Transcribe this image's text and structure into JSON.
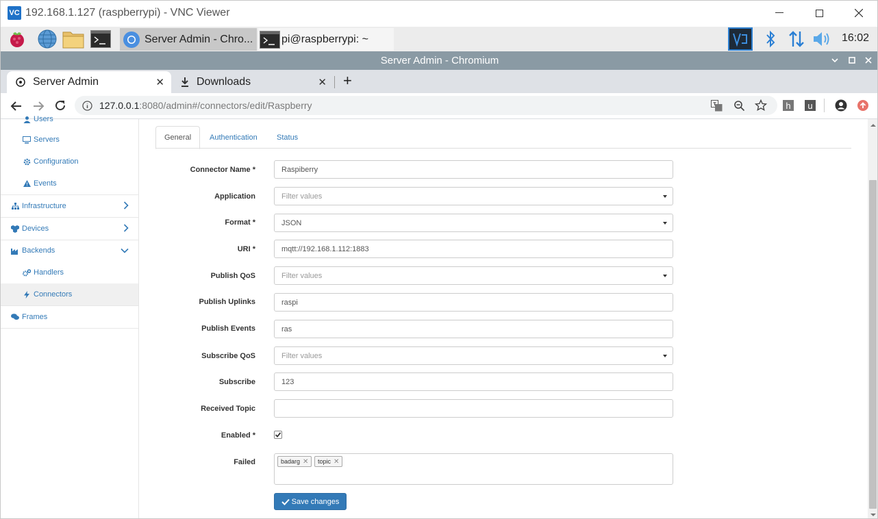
{
  "vnc": {
    "title": "192.168.1.127 (raspberrypi) - VNC Viewer",
    "logo": "VC"
  },
  "taskbar": {
    "tasks": [
      {
        "label": "Server Admin - Chro..."
      },
      {
        "label": "pi@raspberrypi: ~"
      }
    ],
    "clock": "16:02",
    "icons": [
      "raspberry-menu-icon",
      "web-browser-icon",
      "file-manager-icon",
      "terminal-icon",
      "vnc-tray-icon",
      "bluetooth-icon",
      "network-icon",
      "volume-icon"
    ]
  },
  "chromium": {
    "window_title": "Server Admin - Chromium",
    "tabs": [
      {
        "label": "Server Admin"
      },
      {
        "label": "Downloads"
      }
    ],
    "new_tab": "+",
    "url_host": "127.0.0.1",
    "url_rest": ":8080/admin#/connectors/edit/Raspberry",
    "toolbar_icons": [
      "translate-icon",
      "zoom-icon",
      "bookmark-star-icon",
      "extension-h-icon",
      "extension-u-icon",
      "profile-icon",
      "update-icon"
    ],
    "ext_h": "h",
    "ext_u": "u"
  },
  "sidebar": {
    "items": [
      {
        "label": "Users"
      },
      {
        "label": "Servers"
      },
      {
        "label": "Configuration"
      },
      {
        "label": "Events"
      },
      {
        "label": "Infrastructure"
      },
      {
        "label": "Devices"
      },
      {
        "label": "Backends"
      },
      {
        "label": "Handlers"
      },
      {
        "label": "Connectors"
      },
      {
        "label": "Frames"
      }
    ]
  },
  "page": {
    "tabs": [
      {
        "label": "General"
      },
      {
        "label": "Authentication"
      },
      {
        "label": "Status"
      }
    ],
    "fields": [
      {
        "label": "Connector Name *",
        "value": "Raspiberry"
      },
      {
        "label": "Application",
        "placeholder": "Filter values"
      },
      {
        "label": "Format *",
        "value": "JSON"
      },
      {
        "label": "URI *",
        "value": "mqtt://192.168.1.112:1883"
      },
      {
        "label": "Publish QoS",
        "placeholder": "Filter values"
      },
      {
        "label": "Publish Uplinks",
        "value": "raspi"
      },
      {
        "label": "Publish Events",
        "value": "ras"
      },
      {
        "label": "Subscribe QoS",
        "placeholder": "Filter values"
      },
      {
        "label": "Subscribe",
        "value": "123"
      },
      {
        "label": "Received Topic",
        "value": ""
      },
      {
        "label": "Enabled *",
        "checked": true
      },
      {
        "label": "Failed",
        "tags": [
          "badarg",
          "topic"
        ]
      }
    ],
    "save_label": "Save changes",
    "colors": {
      "link": "#337ab7",
      "primary_button": "#337ab7"
    }
  }
}
